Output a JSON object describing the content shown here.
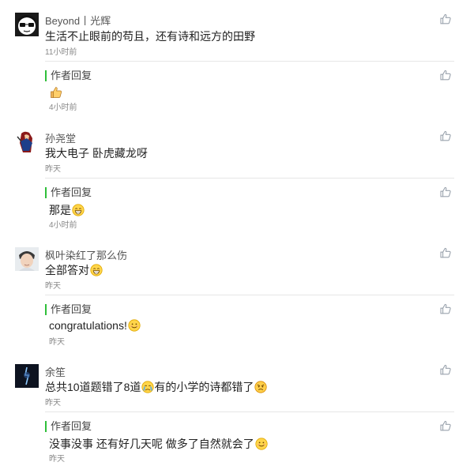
{
  "colors": {
    "reply_accent": "#2fbf3a",
    "like_icon": "#9aa3ad",
    "divider": "#e6e6e6"
  },
  "comments": [
    {
      "user": "Beyond丨光辉",
      "text": "生活不止眼前的苟且，还有诗和远方的田野",
      "time": "11小时前",
      "reply": {
        "label": "作者回复",
        "text_emoji": "thumbs-up-emoji",
        "time": "4小时前"
      }
    },
    {
      "user": "孙尧堂",
      "text": "我大电子 卧虎藏龙呀",
      "time": "昨天",
      "reply": {
        "label": "作者回复",
        "text": "那是",
        "text_emoji": "grin-emoji",
        "time": "4小时前"
      }
    },
    {
      "user": "枫叶染红了那么伤",
      "text": "全部答对",
      "text_emoji": "grin-emoji",
      "time": "昨天",
      "reply": {
        "label": "作者回复",
        "text": "congratulations!",
        "text_emoji": "smile-emoji",
        "time": "昨天"
      }
    },
    {
      "user": "余笙",
      "text_part1": "总共10道题错了8道",
      "text_part2": "有的小学的诗都错了",
      "text_emoji1": "crying-emoji",
      "text_emoji2": "angry-emoji",
      "time": "昨天",
      "reply": {
        "label": "作者回复",
        "text": "没事没事 还有好几天呢 做多了自然就会了",
        "text_emoji": "smile-emoji",
        "time": "昨天"
      }
    }
  ]
}
